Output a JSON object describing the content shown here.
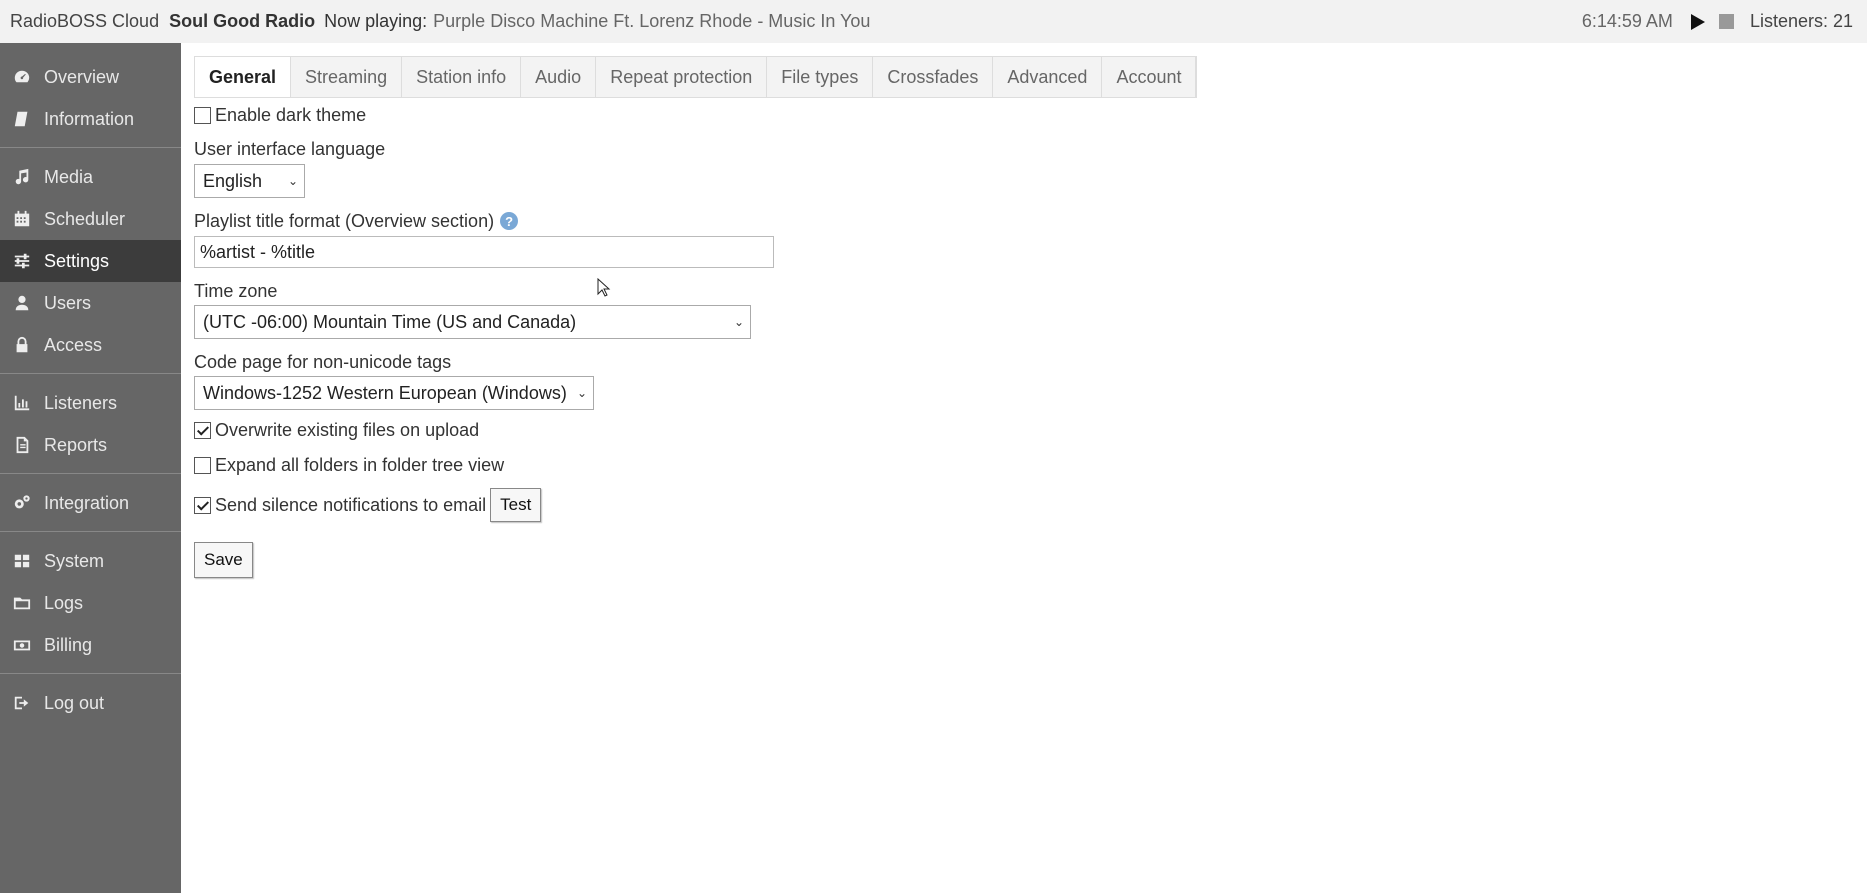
{
  "topbar": {
    "brand": "RadioBOSS Cloud",
    "station": "Soul Good Radio",
    "now_playing_label": "Now playing:",
    "now_playing_value": "Purple Disco Machine Ft. Lorenz Rhode - Music In You",
    "clock": "6:14:59 AM",
    "listeners": "Listeners: 21"
  },
  "sidebar": {
    "items": [
      {
        "label": "Overview",
        "icon": "dashboard-icon"
      },
      {
        "label": "Information",
        "icon": "book-icon"
      },
      {
        "label": "Media",
        "icon": "music-note-icon"
      },
      {
        "label": "Scheduler",
        "icon": "calendar-icon"
      },
      {
        "label": "Settings",
        "icon": "sliders-icon",
        "active": true
      },
      {
        "label": "Users",
        "icon": "user-icon"
      },
      {
        "label": "Access",
        "icon": "lock-icon"
      },
      {
        "label": "Listeners",
        "icon": "bar-chart-icon"
      },
      {
        "label": "Reports",
        "icon": "report-icon"
      },
      {
        "label": "Integration",
        "icon": "gears-icon"
      },
      {
        "label": "System",
        "icon": "grid-icon"
      },
      {
        "label": "Logs",
        "icon": "folder-icon"
      },
      {
        "label": "Billing",
        "icon": "money-icon"
      },
      {
        "label": "Log out",
        "icon": "sign-out-icon"
      }
    ]
  },
  "tabs": [
    "General",
    "Streaming",
    "Station info",
    "Audio",
    "Repeat protection",
    "File types",
    "Crossfades",
    "Advanced",
    "Account"
  ],
  "form": {
    "dark_theme_label": "Enable dark theme",
    "dark_theme_checked": false,
    "language_label": "User interface language",
    "language_value": "English",
    "playlist_format_label": "Playlist title format (Overview section)",
    "playlist_format_value": "%artist - %title",
    "timezone_label": "Time zone",
    "timezone_value": "(UTC -06:00) Mountain Time (US and Canada)",
    "codepage_label": "Code page for non-unicode tags",
    "codepage_value": "Windows-1252 Western European (Windows)",
    "overwrite_label": "Overwrite existing files on upload",
    "overwrite_checked": true,
    "expand_label": "Expand all folders in folder tree view",
    "expand_checked": false,
    "silence_label": "Send silence notifications to email",
    "silence_checked": true,
    "test_button": "Test",
    "save_button": "Save"
  }
}
